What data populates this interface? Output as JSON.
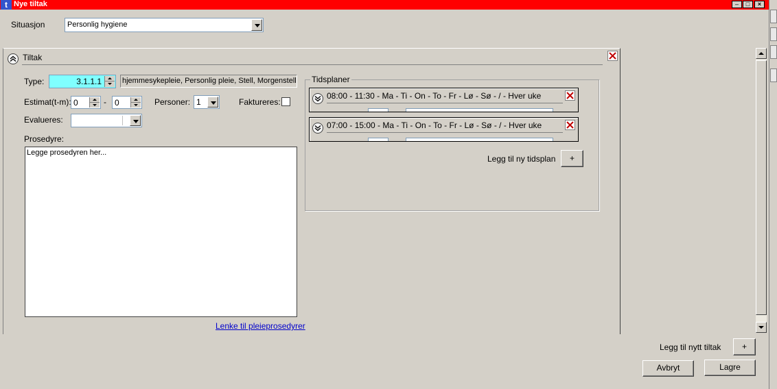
{
  "window": {
    "title": "Nye tiltak",
    "icon": "t",
    "controls": [
      "minimize-icon",
      "maximize-icon",
      "close-icon"
    ]
  },
  "situasjon": {
    "label": "Situasjon",
    "value": "Personlig hygiene"
  },
  "tiltak": {
    "header": "Tiltak",
    "type_label": "Type:",
    "type_code": "3.1.1.1",
    "type_description": "hjemmesykepleie, Personlig pleie, Stell, Morgenstell",
    "estimat_label": "Estimat(t-m):",
    "estimat_hours": "0",
    "estimat_separator": "-",
    "estimat_minutes": "0",
    "personer_label": "Personer:",
    "personer_value": "1",
    "faktureres_label": "Faktureres:",
    "faktureres_checked": false,
    "evalueres_label": "Evalueres:",
    "evalueres_value": "",
    "prosedyre_label": "Prosedyre:",
    "prosedyre_text": "Legge prosedyren her...",
    "link_label": "Lenke til pleieprosedyrer"
  },
  "tidsplaner": {
    "legend": "Tidsplaner",
    "items": [
      {
        "summary": "08:00 - 11:30 - Ma - Ti - On - To - Fr - Lø - Sø -  /  - Hver uke"
      },
      {
        "summary": "07:00 - 15:00 - Ma - Ti - On - To - Fr - Lø - Sø -  /  - Hver uke"
      }
    ],
    "add_label": "Legg til ny tidsplan",
    "add_button": "+"
  },
  "footer": {
    "add_tiltak_label": "Legg til nytt tiltak",
    "add_tiltak_button": "+",
    "cancel": "Avbryt",
    "save": "Lagre"
  },
  "colors": {
    "titlebar": "#ff0000",
    "type_code_bg": "#80ffff",
    "dialog_bg": "#d4d0c8",
    "link": "#0000cc"
  }
}
